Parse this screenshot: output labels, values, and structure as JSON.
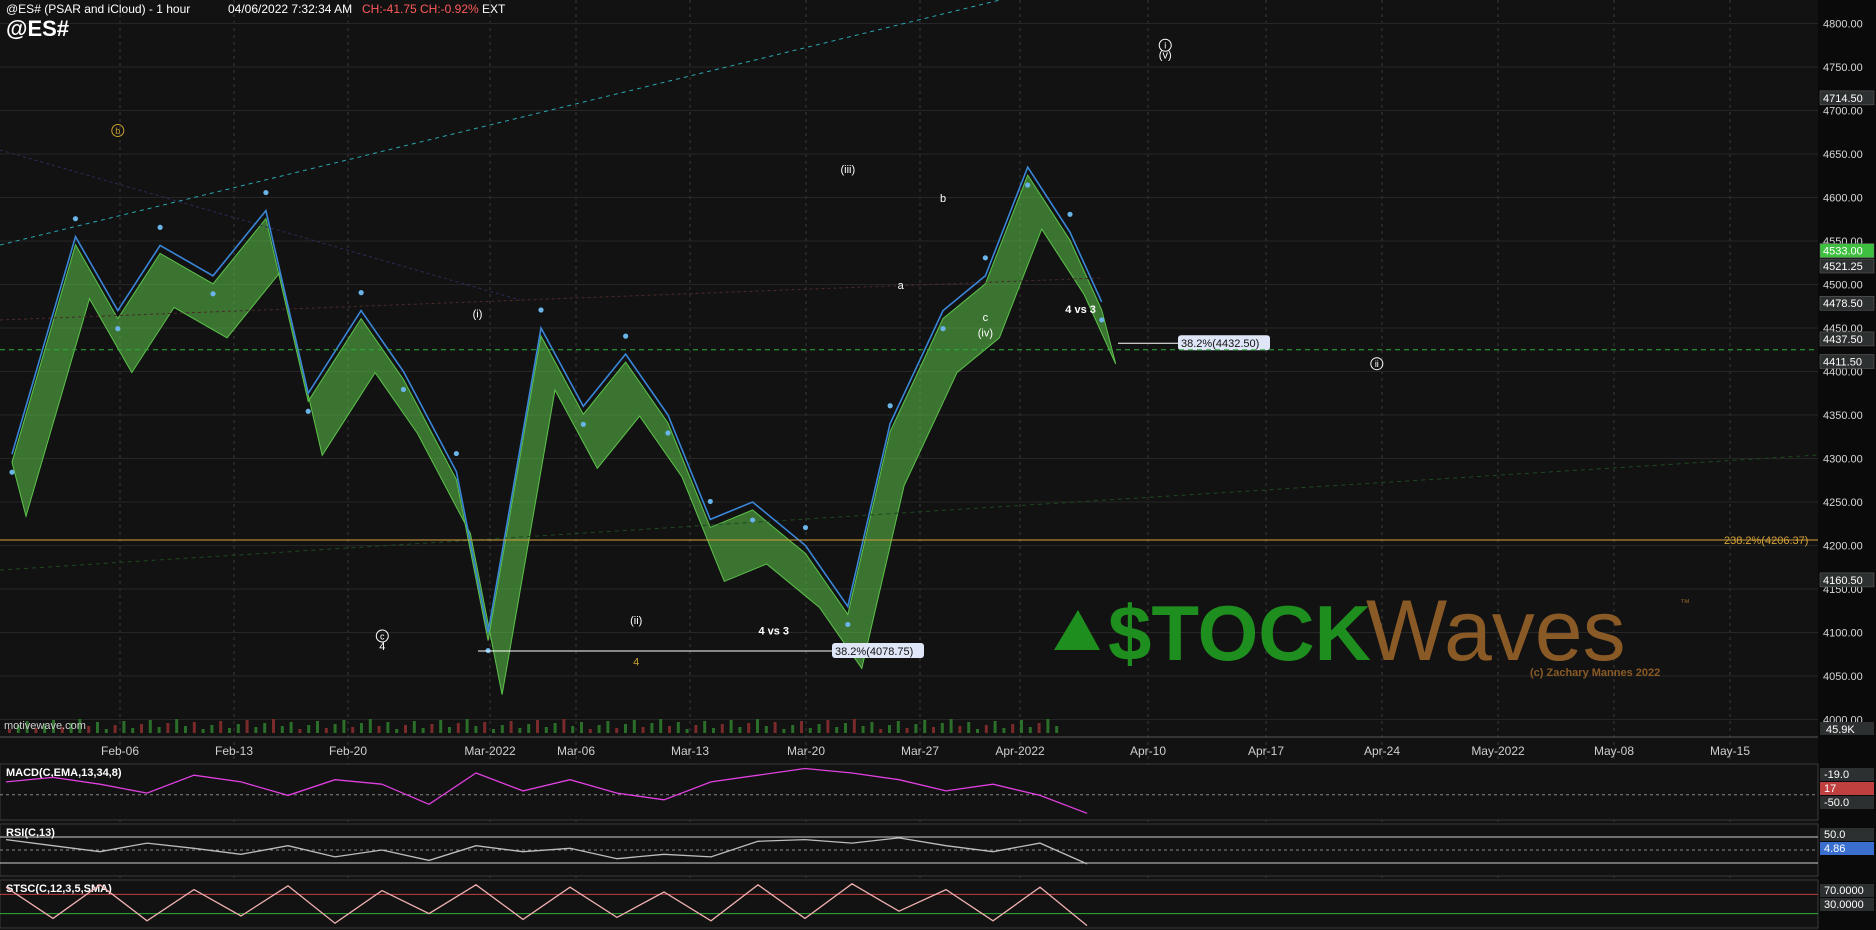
{
  "header": {
    "study": "@ES# (PSAR and iCloud) - 1 hour",
    "datetime": "04/06/2022 7:32:34 AM",
    "change": "CH:-41.75",
    "change_pct": "CH:-0.92%",
    "session": "EXT",
    "symbol": "@ES#",
    "watermark": "motivewave.com"
  },
  "colors": {
    "background": "#121212",
    "grid": "#3a3a3a",
    "price_line": "#3a86d8",
    "psar": "#6ab4e8",
    "cloud_green": "#5cc24a",
    "cloud_red": "#a85a5a",
    "fib_line": "#d6a23a",
    "green_dashed": "#2fae3a",
    "macd": "#e040e0",
    "logo_green": "#1e8e1e",
    "logo_brown": "#8a5a26"
  },
  "logo": {
    "left": "$TOCK",
    "right": "Waves",
    "tm": "™",
    "copyright": "(c) Zachary Mannes 2022"
  },
  "chart_data": [
    {
      "type": "line",
      "name": "main",
      "x_ticks": [
        "Feb-06",
        "Feb-13",
        "Feb-20",
        "Mar-2022",
        "Mar-06",
        "Mar-13",
        "Mar-20",
        "Mar-27",
        "Apr-2022",
        "Apr-10",
        "Apr-17",
        "Apr-24",
        "May-2022",
        "May-08",
        "May-15"
      ],
      "y_ticks": [
        4800,
        4750,
        4700,
        4650,
        4600,
        4550,
        4500,
        4450,
        4400,
        4350,
        4300,
        4250,
        4200,
        4150,
        4100,
        4050,
        4000
      ],
      "ylim": [
        3988,
        4827
      ],
      "price_series": {
        "x": [
          0,
          6,
          10,
          14,
          19,
          24,
          28,
          33,
          37,
          42,
          45,
          50,
          54,
          58,
          62,
          66,
          70,
          75,
          79,
          83,
          88,
          92,
          96,
          100,
          103
        ],
        "y": [
          4305,
          4555,
          4470,
          4545,
          4510,
          4585,
          4375,
          4470,
          4400,
          4285,
          4100,
          4450,
          4360,
          4420,
          4350,
          4230,
          4250,
          4200,
          4130,
          4340,
          4470,
          4510,
          4635,
          4560,
          4480
        ]
      },
      "horizontal_lines": [
        {
          "label": "38.2%(4432.50)",
          "value": 4432.5,
          "style": "solid"
        },
        {
          "label": "38.2%(4078.75)",
          "value": 4078.75,
          "style": "solid"
        },
        {
          "label": "238.2%(4206.37)",
          "value": 4206.37,
          "style": "solid"
        },
        {
          "label": "",
          "value": 4425,
          "style": "dashed"
        }
      ],
      "price_tags": [
        {
          "value": "4714.50",
          "level": 4714.5
        },
        {
          "value": "4533.00",
          "level": 4539
        },
        {
          "value": "4521.25",
          "level": 4521.25
        },
        {
          "value": "4478.50",
          "level": 4478.5
        },
        {
          "value": "4437.50",
          "level": 4437.5
        },
        {
          "value": "4411.50",
          "level": 4411.5
        },
        {
          "value": "4160.50",
          "level": 4160.5
        }
      ],
      "annotations": [
        {
          "text": "(iii)",
          "x": 79,
          "y": 4628
        },
        {
          "text": "(i)",
          "x": 44,
          "y": 4462
        },
        {
          "text": "(ii)",
          "x": 59,
          "y": 4110
        },
        {
          "text": "(iv)",
          "x": 92,
          "y": 4440
        },
        {
          "text": "(v)",
          "x": 109,
          "y": 4760
        },
        {
          "text": "4 vs 3",
          "x": 101,
          "y": 4467
        },
        {
          "text": "4 vs 3",
          "x": 72,
          "y": 4098
        },
        {
          "text": "a",
          "x": 84,
          "y": 4495
        },
        {
          "text": "b",
          "x": 88,
          "y": 4595
        },
        {
          "text": "c",
          "x": 92,
          "y": 4458
        },
        {
          "text": "4",
          "x": 35,
          "y": 4080
        },
        {
          "text": "4",
          "x": 59,
          "y": 4062
        }
      ],
      "circled_labels": [
        {
          "text": "b",
          "x": 10,
          "y": 4677
        },
        {
          "text": "c",
          "x": 35,
          "y": 4096
        },
        {
          "text": "i",
          "x": 109,
          "y": 4775
        },
        {
          "text": "ii",
          "x": 129,
          "y": 4409
        }
      ]
    },
    {
      "type": "line",
      "name": "volume",
      "label": "",
      "axis_tag": "45.9K"
    },
    {
      "type": "line",
      "name": "macd",
      "label": "MACD(C,EMA,13,34,8)",
      "values": [
        2,
        4,
        1,
        -3,
        5,
        2,
        -4,
        3,
        1,
        -8,
        6,
        -2,
        3,
        -3,
        -6,
        2,
        5,
        8,
        6,
        3,
        -2,
        1,
        -4,
        -12
      ],
      "axis_tags": [
        "-19.0",
        "17",
        "-50.0"
      ]
    },
    {
      "type": "line",
      "name": "rsi",
      "label": "RSI(C,13)",
      "values": [
        62,
        55,
        48,
        58,
        52,
        45,
        55,
        42,
        50,
        38,
        55,
        48,
        52,
        40,
        45,
        42,
        60,
        62,
        58,
        64,
        55,
        48,
        58,
        34
      ],
      "axis_tags": [
        "50.0",
        "4.86"
      ]
    },
    {
      "type": "line",
      "name": "stoch",
      "label": "STSC(C,12,3,5,SMA)",
      "values": [
        85,
        20,
        90,
        15,
        80,
        25,
        88,
        10,
        78,
        30,
        90,
        18,
        85,
        22,
        75,
        15,
        90,
        20,
        92,
        35,
        80,
        15,
        85,
        5
      ],
      "axis_tags": [
        "70.0000",
        "30.0000"
      ]
    }
  ]
}
